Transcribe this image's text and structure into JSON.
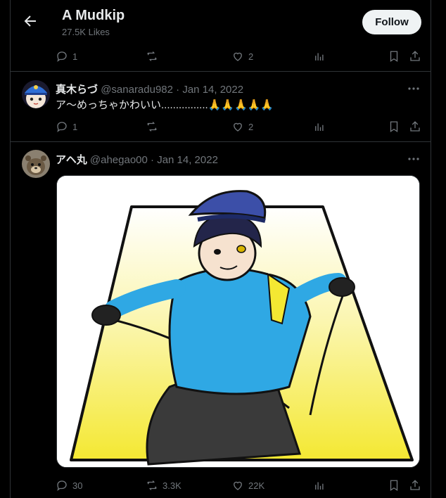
{
  "header": {
    "title": "A Mudkip",
    "subtitle": "27.5K Likes",
    "follow_label": "Follow"
  },
  "top_actions": {
    "replies": "1",
    "reposts": "",
    "likes": "2"
  },
  "tweets": [
    {
      "name": "真木らづ",
      "handle": "@sanaradu982",
      "date": "Jan 14, 2022",
      "text": "ア～めっちゃかわいい................",
      "emoji": "🙏🙏🙏🙏🙏",
      "replies": "1",
      "reposts": "",
      "likes": "2"
    },
    {
      "name": "アヘ丸",
      "handle": "@ahegao00",
      "date": "Jan 14, 2022",
      "replies": "30",
      "reposts": "3.3K",
      "likes": "22K"
    }
  ],
  "separator": "·",
  "icons": {
    "back": "arrow-left-icon",
    "reply": "reply-bubble-icon",
    "repost": "repost-icon",
    "like": "heart-icon",
    "views": "bar-chart-icon",
    "bookmark": "bookmark-icon",
    "share": "share-icon",
    "more": "more-dots-icon"
  },
  "colors": {
    "background": "#000000",
    "text": "#e7e9ea",
    "muted": "#71767b",
    "border": "#2f3336",
    "follow_bg": "#eff3f4"
  }
}
